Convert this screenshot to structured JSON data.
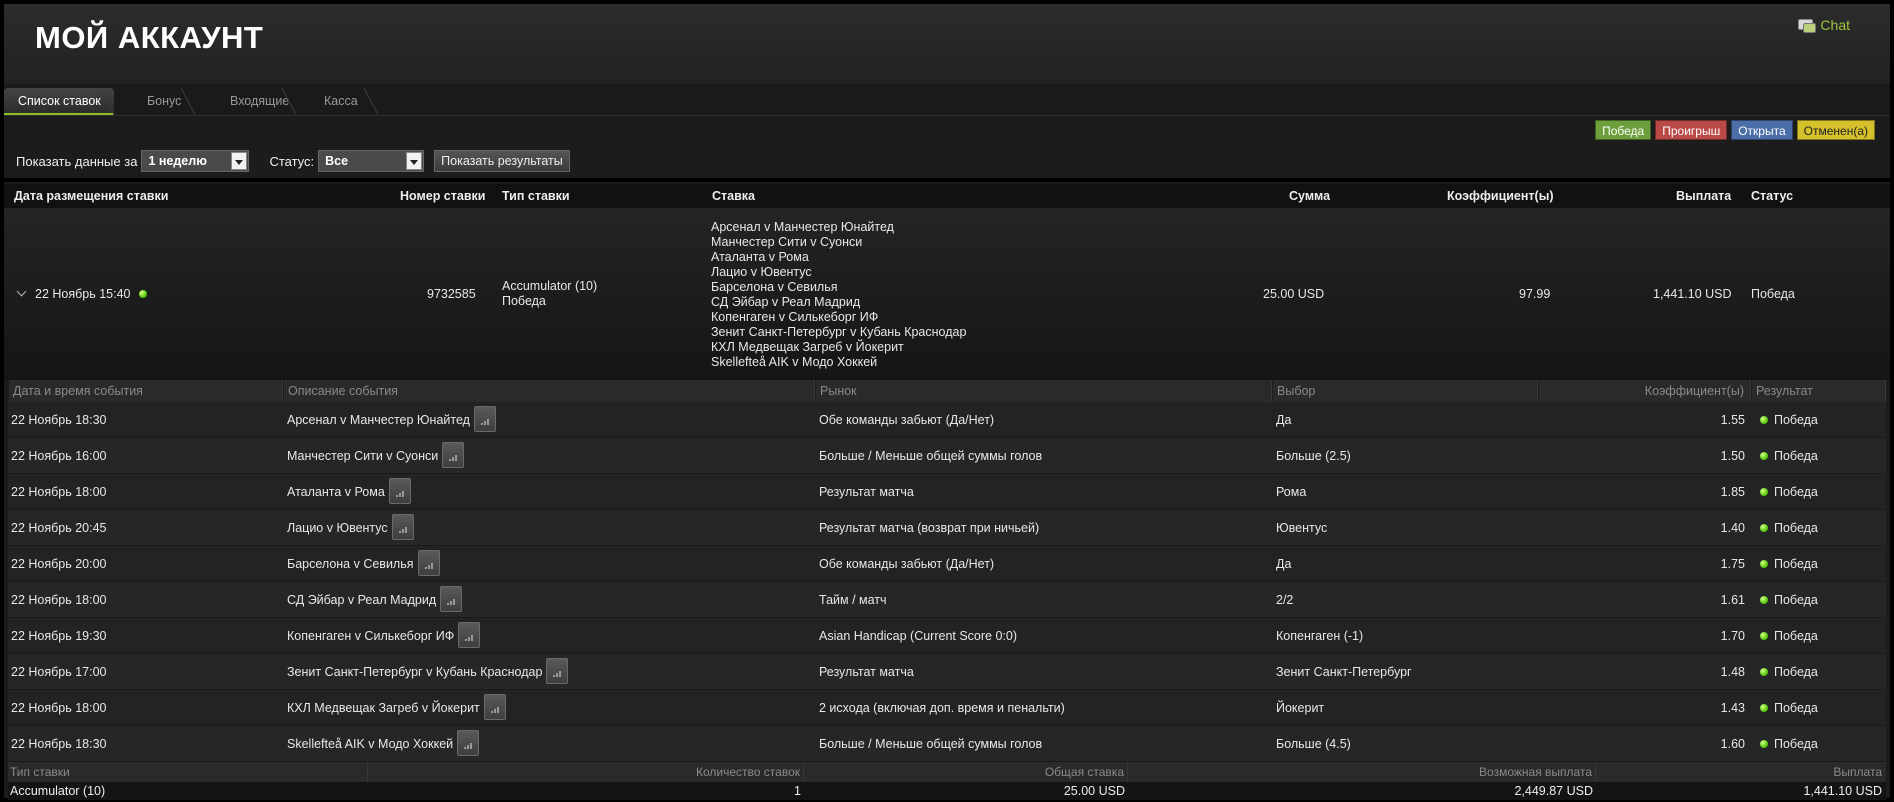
{
  "header": {
    "title": "МОЙ АККАУНТ",
    "chat_label": "Chat"
  },
  "tabs": [
    {
      "label": "Список ставок",
      "active": true
    },
    {
      "label": "Бонус",
      "active": false
    },
    {
      "label": "Входящие",
      "active": false
    },
    {
      "label": "Касса",
      "active": false
    }
  ],
  "legend": {
    "win": "Победа",
    "lose": "Проигрыш",
    "open": "Открыта",
    "cancel": "Отменен(а)"
  },
  "filters": {
    "period_label": "Показать данные за",
    "period_value": "1 неделю",
    "status_label": "Статус:",
    "status_value": "Все",
    "show_button": "Показать результаты"
  },
  "bets_table": {
    "columns": [
      "Дата размещения ставки",
      "Номер ставки",
      "Тип ставки",
      "Ставка",
      "Сумма",
      "Коэффициент(ы)",
      "Выплата",
      "Статус"
    ],
    "bet": {
      "date": "22 Ноябрь 15:40",
      "number": "9732585",
      "type_line1": "Accumulator (10)",
      "type_line2": "Победа",
      "events": [
        "Арсенал v Манчестер Юнайтед",
        "Манчестер Сити v Суонси",
        "Аталанта v Рома",
        "Лацио v Ювентус",
        "Барселона v Севилья",
        "СД Эйбар v Реал Мадрид",
        "Копенгаген v Силькеборг ИФ",
        "Зенит Санкт-Петербург v Кубань Краснодар",
        "КХЛ Медвещак Загреб v Йокерит",
        "Skellefteå AIK v Модо Хоккей"
      ],
      "amount": "25.00 USD",
      "odds": "97.99",
      "payout": "1,441.10 USD",
      "status": "Победа"
    }
  },
  "legs_table": {
    "columns": [
      "Дата и время события",
      "Описание события",
      "Рынок",
      "Выбор",
      "Коэффициент(ы)",
      "Результат"
    ],
    "rows": [
      {
        "date": "22 Ноябрь 18:30",
        "event": "Арсенал v Манчестер Юнайтед",
        "market": "Обе команды забьют (Да/Нет)",
        "pick": "Да",
        "odds": "1.55",
        "result": "Победа"
      },
      {
        "date": "22 Ноябрь 16:00",
        "event": "Манчестер Сити v Суонси",
        "market": "Больше / Меньше общей суммы голов",
        "pick": "Больше (2.5)",
        "odds": "1.50",
        "result": "Победа"
      },
      {
        "date": "22 Ноябрь 18:00",
        "event": "Аталанта v Рома",
        "market": "Результат матча",
        "pick": "Рома",
        "odds": "1.85",
        "result": "Победа"
      },
      {
        "date": "22 Ноябрь 20:45",
        "event": "Лацио v Ювентус",
        "market": "Результат матча (возврат при ничьей)",
        "pick": "Ювентус",
        "odds": "1.40",
        "result": "Победа"
      },
      {
        "date": "22 Ноябрь 20:00",
        "event": "Барселона v Севилья",
        "market": "Обе команды забьют (Да/Нет)",
        "pick": "Да",
        "odds": "1.75",
        "result": "Победа"
      },
      {
        "date": "22 Ноябрь 18:00",
        "event": "СД Эйбар v Реал Мадрид",
        "market": "Тайм / матч",
        "pick": "2/2",
        "odds": "1.61",
        "result": "Победа"
      },
      {
        "date": "22 Ноябрь 19:30",
        "event": "Копенгаген v Силькеборг ИФ",
        "market": "Asian Handicap (Current Score 0:0)",
        "pick": "Копенгаген (-1)",
        "odds": "1.70",
        "result": "Победа"
      },
      {
        "date": "22 Ноябрь 17:00",
        "event": "Зенит Санкт-Петербург v Кубань Краснодар",
        "market": "Результат матча",
        "pick": "Зенит Санкт-Петербург",
        "odds": "1.48",
        "result": "Победа"
      },
      {
        "date": "22 Ноябрь 18:00",
        "event": "КХЛ Медвещак Загреб v Йокерит",
        "market": "2 исхода (включая доп. время и пенальти)",
        "pick": "Йокерит",
        "odds": "1.43",
        "result": "Победа"
      },
      {
        "date": "22 Ноябрь 18:30",
        "event": "Skellefteå AIK v Модо Хоккей",
        "market": "Больше / Меньше общей суммы голов",
        "pick": "Больше (4.5)",
        "odds": "1.60",
        "result": "Победа"
      }
    ]
  },
  "summary": {
    "columns": [
      "Тип ставки",
      "Количество ставок",
      "Общая ставка",
      "Возможная выплата",
      "Выплата"
    ],
    "row": {
      "type": "Accumulator (10)",
      "count": "1",
      "total": "25.00 USD",
      "possible": "2,449.87 USD",
      "payout": "1,441.10 USD"
    }
  },
  "colors": {
    "accent": "#8cbf26",
    "win": "#6da03d",
    "lose": "#b94a48",
    "open": "#4b6ea9",
    "cancel": "#d4c12c"
  }
}
